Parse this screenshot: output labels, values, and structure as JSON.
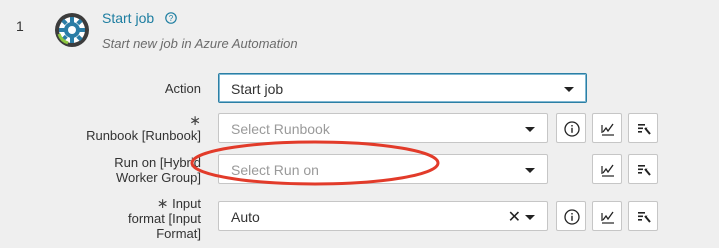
{
  "step": {
    "number": "1",
    "title": "Start job",
    "subtitle": "Start new job in Azure Automation"
  },
  "fields": {
    "action": {
      "label": "Action",
      "value": "Start job"
    },
    "runbook": {
      "required_marker": "∗",
      "label": "Runbook [Runbook]",
      "placeholder": "Select Runbook"
    },
    "run_on": {
      "label_line1": "Run on [Hybrid",
      "label_line2": "Worker Group]",
      "placeholder": "Select Run on"
    },
    "input_format": {
      "required_marker": "∗",
      "label_line1": "Input",
      "label_line2": "format [Input",
      "label_line3": "Format]",
      "value": "Auto",
      "clear_glyph": "✕"
    }
  },
  "icons": {
    "step": "azure-automation-gear-icon",
    "help": "question-circle-icon",
    "info": "info-circle-icon",
    "expression": "function-expression-icon",
    "picker": "list-picker-icon"
  },
  "colors": {
    "title": "#1e7ea1",
    "annotation": "#e23b2a",
    "focus_border": "#2c7fa4"
  }
}
